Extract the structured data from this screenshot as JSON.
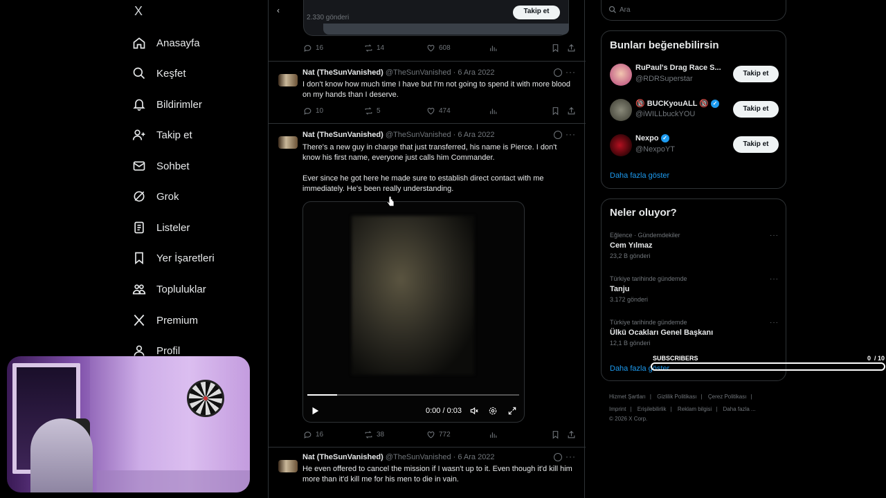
{
  "nav": {
    "logo": "X",
    "items": [
      {
        "label": "Anasayfa",
        "icon": "home-icon"
      },
      {
        "label": "Keşfet",
        "icon": "search-icon"
      },
      {
        "label": "Bildirimler",
        "icon": "bell-icon"
      },
      {
        "label": "Takip et",
        "icon": "person-add-icon"
      },
      {
        "label": "Sohbet",
        "icon": "mail-icon"
      },
      {
        "label": "Grok",
        "icon": "grok-icon"
      },
      {
        "label": "Listeler",
        "icon": "list-icon"
      },
      {
        "label": "Yer İşaretleri",
        "icon": "bookmark-icon"
      },
      {
        "label": "Topluluklar",
        "icon": "communities-icon"
      },
      {
        "label": "Premium",
        "icon": "x-premium-icon"
      },
      {
        "label": "Profil",
        "icon": "profile-icon"
      }
    ]
  },
  "feed": {
    "top_card": {
      "count": "2.330 gönderi",
      "follow": "Takip et"
    },
    "top_actions": {
      "replies": "16",
      "reposts": "14",
      "likes": "608"
    },
    "tweets": [
      {
        "name": "Nat (TheSunVanished)",
        "meta": "@TheSunVanished · 6 Ara 2022",
        "text": "I don't know how much time I have but I'm not going to spend it with more blood on my hands than I deserve.",
        "replies": "10",
        "reposts": "5",
        "likes": "474"
      },
      {
        "name": "Nat (TheSunVanished)",
        "meta": "@TheSunVanished · 6 Ara 2022",
        "text": "There's a new guy in charge that just transferred, his name is Pierce. I don't know his first name, everyone just calls him Commander.",
        "text2": "Ever since he got here he made sure to establish direct contact with me immediately. He's been really understanding.",
        "video_time": "0:00 / 0:03",
        "video_progress": 0.14,
        "replies": "16",
        "reposts": "38",
        "likes": "772"
      },
      {
        "name": "Nat (TheSunVanished)",
        "meta": "@TheSunVanished · 6 Ara 2022",
        "text": "He even offered to cancel the mission if I wasn't up to it. Even though it'd kill him more than it'd kill me for his men to die in vain."
      }
    ]
  },
  "search": {
    "placeholder": "Ara"
  },
  "who_to_follow": {
    "title": "Bunları beğenebilirsin",
    "accounts": [
      {
        "name": "RuPaul's Drag Race S...",
        "handle": "@RDRSuperstar",
        "button": "Takip et"
      },
      {
        "name": "🔞 BUCKyouALL 🔞",
        "handle": "@iWILLbuckYOU",
        "button": "Takip et",
        "verified": true
      },
      {
        "name": "Nexpo",
        "handle": "@NexpoYT",
        "button": "Takip et",
        "verified": true
      }
    ],
    "more": "Daha fazla göster"
  },
  "trends": {
    "title": "Neler oluyor?",
    "items": [
      {
        "category": "Eğlence · Gündemdekiler",
        "title": "Cem Yılmaz",
        "count": "23,2 B gönderi"
      },
      {
        "category": "Türkiye tarihinde gündemde",
        "title": "Tanju",
        "count": "3.172 gönderi"
      },
      {
        "category": "Türkiye tarihinde gündemde",
        "title": "Ülkü Ocakları Genel Başkanı",
        "count": "12,1 B gönderi"
      }
    ],
    "more": "Daha fazla göster"
  },
  "footer": {
    "links1": [
      "Hizmet Şartları",
      "|",
      "Gizlilik Politikası",
      "|",
      "Çerez Politikası",
      "|"
    ],
    "links2": [
      "Imprint",
      "|",
      "Erişilebilirlik",
      "|",
      "Reklam bilgisi",
      "|",
      "Daha fazla ..."
    ],
    "copyright": "© 2026 X Corp."
  },
  "overlay": {
    "subscribers_label": "SUBSCRIBERS",
    "subscribers_count": "0",
    "subscribers_goal": "/ 10",
    "subscribers_progress": 0
  },
  "colors": {
    "accent": "#1d9bf0",
    "bg": "#000000",
    "text": "#e7e9ea",
    "muted": "#71767b",
    "border": "#2f3336"
  }
}
